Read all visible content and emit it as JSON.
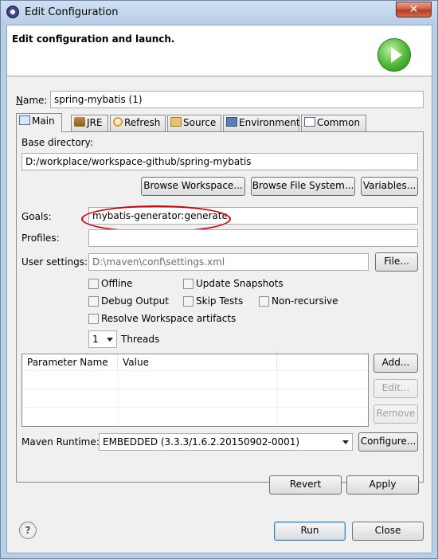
{
  "window": {
    "title": "Edit Configuration",
    "close_glyph": "✕"
  },
  "header": {
    "title": "Edit configuration and launch.",
    "icon": "run-icon"
  },
  "name": {
    "label": "Name:",
    "value": "spring-mybatis (1)"
  },
  "tabs": [
    {
      "label": "Main",
      "icon": "main-icon"
    },
    {
      "label": "JRE",
      "icon": "jre-icon"
    },
    {
      "label": "Refresh",
      "icon": "refresh-icon"
    },
    {
      "label": "Source",
      "icon": "source-icon"
    },
    {
      "label": "Environment",
      "icon": "environment-icon"
    },
    {
      "label": "Common",
      "icon": "common-icon"
    }
  ],
  "base_directory": {
    "label": "Base directory:",
    "value": "D:/workplace/workspace-github/spring-mybatis",
    "browse_workspace": "Browse Workspace...",
    "browse_file_system": "Browse File System...",
    "variables": "Variables..."
  },
  "goals": {
    "label": "Goals:",
    "value": "mybatis-generator:generate"
  },
  "profiles": {
    "label": "Profiles:",
    "value": ""
  },
  "user_settings": {
    "label": "User settings:",
    "value": "D:\\maven\\conf\\settings.xml",
    "file_button": "File..."
  },
  "options": {
    "offline": "Offline",
    "update_snapshots": "Update Snapshots",
    "debug_output": "Debug Output",
    "skip_tests": "Skip Tests",
    "non_recursive": "Non-recursive",
    "resolve_workspace": "Resolve Workspace artifacts"
  },
  "threads": {
    "value": "1",
    "label": "Threads"
  },
  "parameters": {
    "columns": [
      "Parameter Name",
      "Value"
    ],
    "add": "Add...",
    "edit": "Edit...",
    "remove": "Remove"
  },
  "maven_runtime": {
    "label": "Maven Runtime:",
    "value": "EMBEDDED (3.3.3/1.6.2.20150902-0001)",
    "configure": "Configure..."
  },
  "buttons": {
    "revert": "Revert",
    "apply": "Apply",
    "run": "Run",
    "close": "Close",
    "help": "?"
  },
  "colors": {
    "highlight_ellipse": "#d40000",
    "run_badge": "#4fb635"
  }
}
